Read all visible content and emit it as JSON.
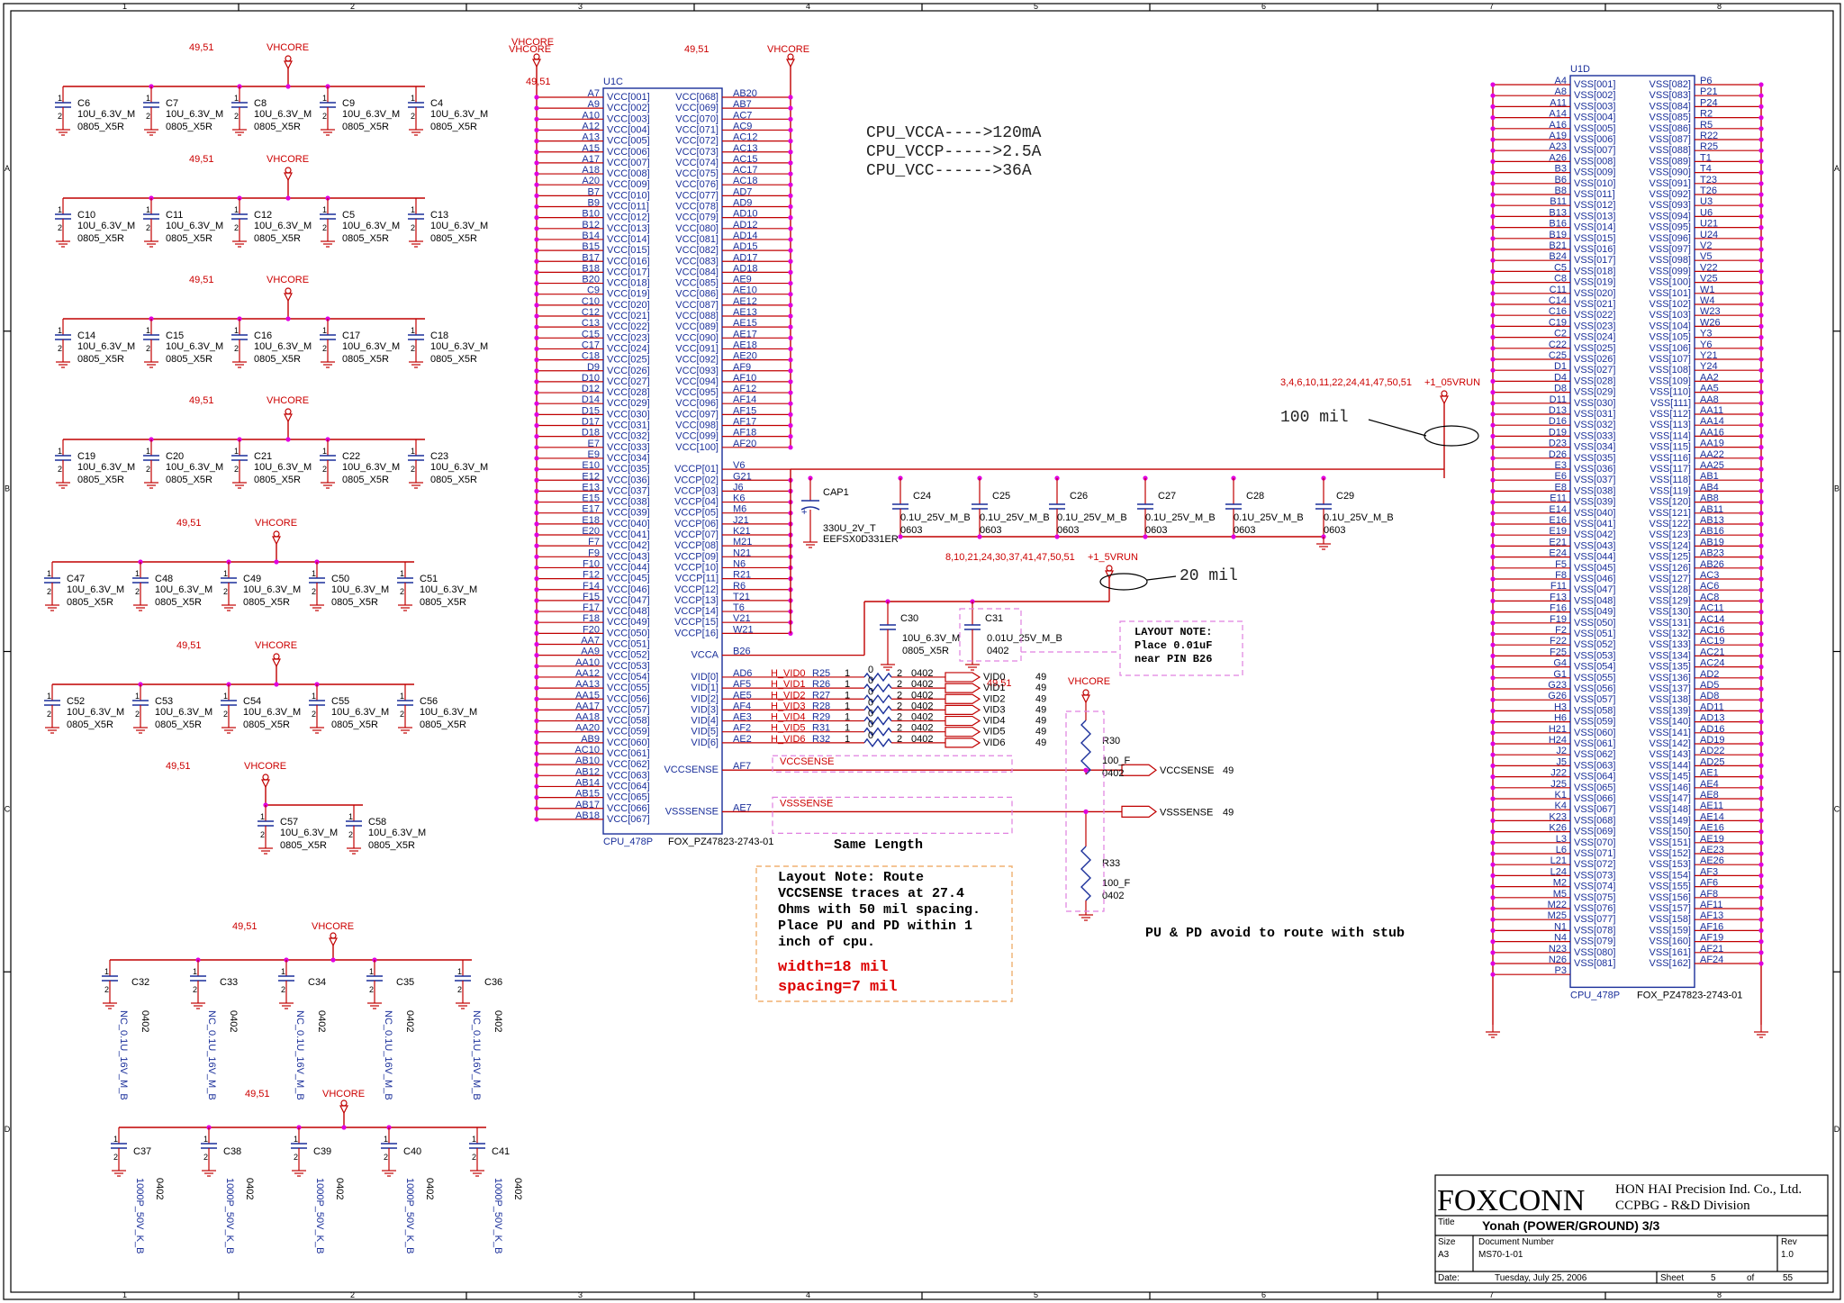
{
  "frame": {
    "cols": [
      "1",
      "2",
      "3",
      "4",
      "5",
      "6",
      "7",
      "8"
    ],
    "rows": [
      "A",
      "B",
      "C",
      "D"
    ]
  },
  "net_labels": {
    "vhcore": "VHCORE",
    "refs_4951": "49,51",
    "run_1_05": "+1_05VRUN",
    "run_1_05_refs": "3,4,6,10,11,22,24,41,47,50,51",
    "run_1_5": "+1_5VRUN",
    "run_1_5_refs": "8,10,21,24,30,37,41,47,50,51",
    "vccsense": "VCCSENSE",
    "vsssense": "VSSSENSE",
    "ref49": "49"
  },
  "cap_values": {
    "c10u": "10U_6.3V_M",
    "pkg0805": "0805_X5R",
    "c01u": "0.1U_25V_M_B",
    "pkg0603": "0603",
    "c001u": "0.01U_25V_M_B",
    "pkg0402": "0402",
    "nc01u": "NC_0.1U_16V_M_B",
    "c1000p": "1000P_50V_K_B",
    "cap1_val": "330U_2V_T",
    "cap1_part": "EEFSX0D331ER"
  },
  "cap_groups": [
    {
      "refs": [
        "C6",
        "C7",
        "C8",
        "C9",
        "C4"
      ]
    },
    {
      "refs": [
        "C10",
        "C11",
        "C12",
        "C5",
        "C13"
      ]
    },
    {
      "refs": [
        "C14",
        "C15",
        "C16",
        "C17",
        "C18"
      ]
    },
    {
      "refs": [
        "C19",
        "C20",
        "C21",
        "C22",
        "C23"
      ]
    },
    {
      "refs": [
        "C47",
        "C48",
        "C49",
        "C50",
        "C51"
      ]
    },
    {
      "refs": [
        "C52",
        "C53",
        "C54",
        "C55",
        "C56"
      ]
    },
    {
      "refs": [
        "C57",
        "C58"
      ]
    }
  ],
  "nc_caps": [
    "C32",
    "C33",
    "C34",
    "C35",
    "C36"
  ],
  "pf_caps": [
    "C37",
    "C38",
    "C39",
    "C40",
    "C41"
  ],
  "vccp_caps": [
    "C24",
    "C25",
    "C26",
    "C27",
    "C28",
    "C29"
  ],
  "u1c": {
    "ref": "U1C",
    "part": "CPU_478P",
    "footprint": "FOX_PZ47823-2743-01",
    "left_pins": [
      "A7",
      "A9",
      "A10",
      "A12",
      "A13",
      "A15",
      "A17",
      "A18",
      "A20",
      "B7",
      "B9",
      "B10",
      "B12",
      "B14",
      "B15",
      "B17",
      "B18",
      "B20",
      "C9",
      "C10",
      "C12",
      "C13",
      "C15",
      "C17",
      "C18",
      "D9",
      "D10",
      "D12",
      "D14",
      "D15",
      "D17",
      "D18",
      "E7",
      "E9",
      "E10",
      "E12",
      "E13",
      "E15",
      "E17",
      "E18",
      "E20",
      "F7",
      "F9",
      "F10",
      "F12",
      "F14",
      "F15",
      "F17",
      "F18",
      "F20",
      "AA7",
      "AA9",
      "AA10",
      "AA12",
      "AA13",
      "AA15",
      "AA17",
      "AA18",
      "AA20",
      "AB9",
      "AC10",
      "AB10",
      "AB12",
      "AB14",
      "AB15",
      "AB17",
      "AB18"
    ],
    "vcc_labels": [
      "VCC[001]",
      "VCC[002]",
      "VCC[003]",
      "VCC[004]",
      "VCC[005]",
      "VCC[006]",
      "VCC[007]",
      "VCC[008]",
      "VCC[009]",
      "VCC[010]",
      "VCC[011]",
      "VCC[012]",
      "VCC[013]",
      "VCC[014]",
      "VCC[015]",
      "VCC[016]",
      "VCC[017]",
      "VCC[018]",
      "VCC[019]",
      "VCC[020]",
      "VCC[021]",
      "VCC[022]",
      "VCC[023]",
      "VCC[024]",
      "VCC[025]",
      "VCC[026]",
      "VCC[027]",
      "VCC[028]",
      "VCC[029]",
      "VCC[030]",
      "VCC[031]",
      "VCC[032]",
      "VCC[033]",
      "VCC[034]",
      "VCC[035]",
      "VCC[036]",
      "VCC[037]",
      "VCC[038]",
      "VCC[039]",
      "VCC[040]",
      "VCC[041]",
      "VCC[042]",
      "VCC[043]",
      "VCC[044]",
      "VCC[045]",
      "VCC[046]",
      "VCC[047]",
      "VCC[048]",
      "VCC[049]",
      "VCC[050]",
      "VCC[051]",
      "VCC[052]",
      "VCC[053]",
      "VCC[054]",
      "VCC[055]",
      "VCC[056]",
      "VCC[057]",
      "VCC[058]",
      "VCC[059]",
      "VCC[060]",
      "VCC[061]",
      "VCC[062]",
      "VCC[063]",
      "VCC[064]",
      "VCC[065]",
      "VCC[066]",
      "VCC[067]"
    ],
    "right_top_labels": [
      "VCC[068]",
      "VCC[069]",
      "VCC[070]",
      "VCC[071]",
      "VCC[072]",
      "VCC[073]",
      "VCC[074]",
      "VCC[075]",
      "VCC[076]",
      "VCC[077]",
      "VCC[078]",
      "VCC[079]",
      "VCC[080]",
      "VCC[081]",
      "VCC[082]",
      "VCC[083]",
      "VCC[084]",
      "VCC[085]",
      "VCC[086]",
      "VCC[087]",
      "VCC[088]",
      "VCC[089]",
      "VCC[090]",
      "VCC[091]",
      "VCC[092]",
      "VCC[093]",
      "VCC[094]",
      "VCC[095]",
      "VCC[096]",
      "VCC[097]",
      "VCC[098]",
      "VCC[099]",
      "VCC[100]"
    ],
    "right_top_pins": [
      "AB20",
      "AB7",
      "AC7",
      "AC9",
      "AC12",
      "AC13",
      "AC15",
      "AC17",
      "AC18",
      "AD7",
      "AD9",
      "AD10",
      "AD12",
      "AD14",
      "AD15",
      "AD17",
      "AD18",
      "AE9",
      "AE10",
      "AE12",
      "AE13",
      "AE15",
      "AE17",
      "AE18",
      "AE20",
      "AF9",
      "AF10",
      "AF12",
      "AF14",
      "AF15",
      "AF17",
      "AF18",
      "AF20"
    ],
    "vccp_labels": [
      "VCCP[01]",
      "VCCP[02]",
      "VCCP[03]",
      "VCCP[04]",
      "VCCP[05]",
      "VCCP[06]",
      "VCCP[07]",
      "VCCP[08]",
      "VCCP[09]",
      "VCCP[10]",
      "VCCP[11]",
      "VCCP[12]",
      "VCCP[13]",
      "VCCP[14]",
      "VCCP[15]",
      "VCCP[16]"
    ],
    "vccp_pins": [
      "V6",
      "G21",
      "J6",
      "K6",
      "M6",
      "J21",
      "K21",
      "M21",
      "N21",
      "N6",
      "R21",
      "R6",
      "T21",
      "T6",
      "V21",
      "W21"
    ],
    "vcca_label": "VCCA",
    "vcca_pin": "B26",
    "vid_labels": [
      "VID[0]",
      "VID[1]",
      "VID[2]",
      "VID[3]",
      "VID[4]",
      "VID[5]",
      "VID[6]"
    ],
    "vid_pins": [
      "AD6",
      "AF5",
      "AE5",
      "AF4",
      "AE3",
      "AF2",
      "AE2"
    ],
    "vccsense_label": "VCCSENSE",
    "vccsense_pin": "AF7",
    "vsssense_label": "VSSSENSE",
    "vsssense_pin": "AE7"
  },
  "vid_nets": {
    "hvid": [
      "H_VID0",
      "H_VID1",
      "H_VID2",
      "H_VID3",
      "H_VID4",
      "H_VID5",
      "H_VID6"
    ],
    "res": [
      "R25",
      "R26",
      "R27",
      "R28",
      "R29",
      "R31",
      "R32"
    ],
    "vid": [
      "VID0",
      "VID1",
      "VID2",
      "VID3",
      "VID4",
      "VID5",
      "VID6"
    ],
    "res_val": "0",
    "pin1": "1",
    "pin2": "2",
    "pkg": "0402",
    "ref": "49"
  },
  "sense_res": [
    {
      "ref": "R30",
      "val": "100_F",
      "pkg": "0402"
    },
    {
      "ref": "R33",
      "val": "100_F",
      "pkg": "0402"
    }
  ],
  "misc_refs": {
    "cap1": "CAP1",
    "c30": "C30",
    "c31": "C31"
  },
  "currents": [
    "CPU_VCCA---->120mA",
    "CPU_VCCP----->2.5A",
    "CPU_VCC------>36A"
  ],
  "annotations": {
    "mil100": "100 mil",
    "mil20": "20 mil",
    "same_length": "Same Length",
    "pupd": "PU & PD avoid to route with stub"
  },
  "layout_note_small": [
    "LAYOUT NOTE:",
    "Place 0.01uF",
    "near PIN B26"
  ],
  "layout_note_big": [
    "Layout Note: Route",
    "VCCSENSE traces at 27.4",
    "Ohms with 50 mil spacing.",
    "Place PU and PD within 1",
    "inch of cpu."
  ],
  "layout_note_red": [
    "width=18 mil",
    "spacing=7 mil"
  ],
  "u1d": {
    "ref": "U1D",
    "part": "CPU_478P",
    "footprint": "FOX_PZ47823-2743-01",
    "left_pins": [
      "A4",
      "A8",
      "A11",
      "A14",
      "A16",
      "A19",
      "A23",
      "A26",
      "B3",
      "B6",
      "B8",
      "B11",
      "B13",
      "B16",
      "B19",
      "B21",
      "B24",
      "C5",
      "C8",
      "C11",
      "C14",
      "C16",
      "C19",
      "C2",
      "C22",
      "C25",
      "D1",
      "D4",
      "D8",
      "D11",
      "D13",
      "D16",
      "D19",
      "D23",
      "D26",
      "E3",
      "E6",
      "E8",
      "E11",
      "E14",
      "E16",
      "E19",
      "E21",
      "E24",
      "F5",
      "F8",
      "F11",
      "F13",
      "F16",
      "F19",
      "F2",
      "F22",
      "F25",
      "G4",
      "G1",
      "G23",
      "G26",
      "H3",
      "H6",
      "H21",
      "H24",
      "J2",
      "J5",
      "J22",
      "J25",
      "K1",
      "K4",
      "K23",
      "K26",
      "L3",
      "L6",
      "L21",
      "L24",
      "M2",
      "M5",
      "M22",
      "M25",
      "N1",
      "N4",
      "N23",
      "N26",
      "P3"
    ],
    "left_labels": [
      "VSS[001]",
      "VSS[002]",
      "VSS[003]",
      "VSS[004]",
      "VSS[005]",
      "VSS[006]",
      "VSS[007]",
      "VSS[008]",
      "VSS[009]",
      "VSS[010]",
      "VSS[011]",
      "VSS[012]",
      "VSS[013]",
      "VSS[014]",
      "VSS[015]",
      "VSS[016]",
      "VSS[017]",
      "VSS[018]",
      "VSS[019]",
      "VSS[020]",
      "VSS[021]",
      "VSS[022]",
      "VSS[023]",
      "VSS[024]",
      "VSS[025]",
      "VSS[026]",
      "VSS[027]",
      "VSS[028]",
      "VSS[029]",
      "VSS[030]",
      "VSS[031]",
      "VSS[032]",
      "VSS[033]",
      "VSS[034]",
      "VSS[035]",
      "VSS[036]",
      "VSS[037]",
      "VSS[038]",
      "VSS[039]",
      "VSS[040]",
      "VSS[041]",
      "VSS[042]",
      "VSS[043]",
      "VSS[044]",
      "VSS[045]",
      "VSS[046]",
      "VSS[047]",
      "VSS[048]",
      "VSS[049]",
      "VSS[050]",
      "VSS[051]",
      "VSS[052]",
      "VSS[053]",
      "VSS[054]",
      "VSS[055]",
      "VSS[056]",
      "VSS[057]",
      "VSS[058]",
      "VSS[059]",
      "VSS[060]",
      "VSS[061]",
      "VSS[062]",
      "VSS[063]",
      "VSS[064]",
      "VSS[065]",
      "VSS[066]",
      "VSS[067]",
      "VSS[068]",
      "VSS[069]",
      "VSS[070]",
      "VSS[071]",
      "VSS[072]",
      "VSS[073]",
      "VSS[074]",
      "VSS[075]",
      "VSS[076]",
      "VSS[077]",
      "VSS[078]",
      "VSS[079]",
      "VSS[080]",
      "VSS[081]"
    ],
    "right_labels": [
      "VSS[082]",
      "VSS[083]",
      "VSS[084]",
      "VSS[085]",
      "VSS[086]",
      "VSS[087]",
      "VSS[088]",
      "VSS[089]",
      "VSS[090]",
      "VSS[091]",
      "VSS[092]",
      "VSS[093]",
      "VSS[094]",
      "VSS[095]",
      "VSS[096]",
      "VSS[097]",
      "VSS[098]",
      "VSS[099]",
      "VSS[100]",
      "VSS[101]",
      "VSS[102]",
      "VSS[103]",
      "VSS[104]",
      "VSS[105]",
      "VSS[106]",
      "VSS[107]",
      "VSS[108]",
      "VSS[109]",
      "VSS[110]",
      "VSS[111]",
      "VSS[112]",
      "VSS[113]",
      "VSS[114]",
      "VSS[115]",
      "VSS[116]",
      "VSS[117]",
      "VSS[118]",
      "VSS[119]",
      "VSS[120]",
      "VSS[121]",
      "VSS[122]",
      "VSS[123]",
      "VSS[124]",
      "VSS[125]",
      "VSS[126]",
      "VSS[127]",
      "VSS[128]",
      "VSS[129]",
      "VSS[130]",
      "VSS[131]",
      "VSS[132]",
      "VSS[133]",
      "VSS[134]",
      "VSS[135]",
      "VSS[136]",
      "VSS[137]",
      "VSS[138]",
      "VSS[139]",
      "VSS[140]",
      "VSS[141]",
      "VSS[142]",
      "VSS[143]",
      "VSS[144]",
      "VSS[145]",
      "VSS[146]",
      "VSS[147]",
      "VSS[148]",
      "VSS[149]",
      "VSS[150]",
      "VSS[151]",
      "VSS[152]",
      "VSS[153]",
      "VSS[154]",
      "VSS[155]",
      "VSS[156]",
      "VSS[157]",
      "VSS[158]",
      "VSS[159]",
      "VSS[160]",
      "VSS[161]",
      "VSS[162]"
    ],
    "right_pins": [
      "P6",
      "P21",
      "P24",
      "R2",
      "R5",
      "R22",
      "R25",
      "T1",
      "T4",
      "T23",
      "T26",
      "U3",
      "U6",
      "U21",
      "U24",
      "V2",
      "V5",
      "V22",
      "V25",
      "W1",
      "W4",
      "W23",
      "W26",
      "Y3",
      "Y6",
      "Y21",
      "Y24",
      "AA2",
      "AA5",
      "AA8",
      "AA11",
      "AA14",
      "AA16",
      "AA19",
      "AA22",
      "AA25",
      "AB1",
      "AB4",
      "AB8",
      "AB11",
      "AB13",
      "AB16",
      "AB19",
      "AB23",
      "AB26",
      "AC3",
      "AC6",
      "AC8",
      "AC11",
      "AC14",
      "AC16",
      "AC19",
      "AC21",
      "AC24",
      "AD2",
      "AD5",
      "AD8",
      "AD11",
      "AD13",
      "AD16",
      "AD19",
      "AD22",
      "AD25",
      "AE1",
      "AE4",
      "AE8",
      "AE11",
      "AE14",
      "AE16",
      "AE19",
      "AE23",
      "AE26",
      "AF3",
      "AF6",
      "AF8",
      "AF11",
      "AF13",
      "AF16",
      "AF19",
      "AF21",
      "AF24"
    ]
  },
  "title_block": {
    "company": "FOXCONN",
    "division_line1": "HON HAI Precision Ind. Co., Ltd.",
    "division_line2": "CCPBG - R&D Division",
    "title_label": "Title",
    "title": "Yonah (POWER/GROUND) 3/3",
    "size_label": "Size",
    "size": "A3",
    "docnum_label": "Document Number",
    "docnum": "MS70-1-01",
    "rev_label": "Rev",
    "rev": "1.0",
    "date_label": "Date:",
    "date": "Tuesday, July 25, 2006",
    "sheet_label": "Sheet",
    "sheet": "5",
    "of_label": "of",
    "total": "55"
  }
}
